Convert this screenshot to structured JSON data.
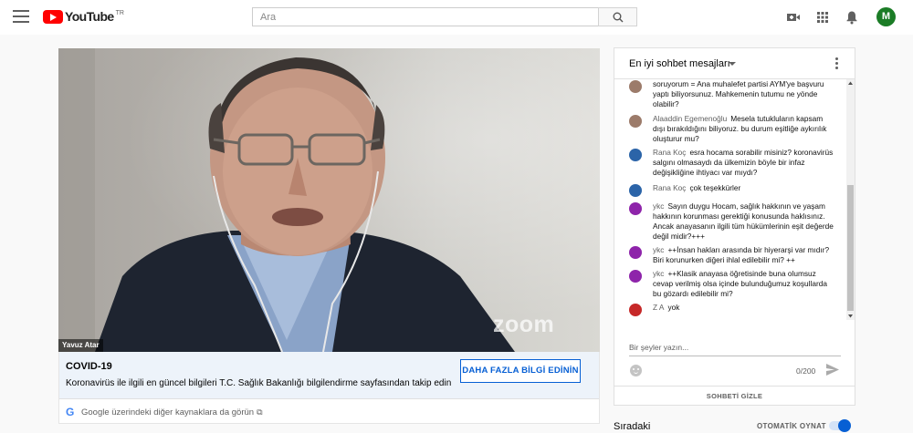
{
  "header": {
    "logo_text": "YouTube",
    "logo_country": "TR",
    "search_placeholder": "Ara",
    "icons": [
      "menu-icon",
      "search-icon",
      "create-video-icon",
      "apps-icon",
      "notifications-icon"
    ],
    "avatar_letter": "M",
    "avatar_color": "#1b7c26"
  },
  "video": {
    "speaker_name": "Yavuz Atar",
    "watermark": "zoom"
  },
  "info_panel": {
    "title": "COVID-19",
    "description": "Koronavirüs ile ilgili en güncel bilgileri T.C. Sağlık Bakanlığı bilgilendirme sayfasından takip edin",
    "button_label": "DAHA FAZLA BİLGİ EDİNİN",
    "source_link": "Google üzerindeki diğer kaynaklara da görün"
  },
  "chat": {
    "mode_label": "En iyi sohbet mesajları",
    "messages": [
      {
        "author": "",
        "text": "soruyorum = Ana muhalefet partisi AYM'ye başvuru yaptı biliyorsunuz. Mahkemenin tutumu ne yönde olabilir?",
        "avatar_color": "#9c7b6a"
      },
      {
        "author": "Alaaddin Egemenoğlu",
        "text": "Mesela tutukluların kapsam dışı bırakıldığını biliyoruz. bu durum eşitliğe aykırılık oluşturur mu?",
        "avatar_color": "#9c7b6a"
      },
      {
        "author": "Rana Koç",
        "text": "esra hocama sorabilir misiniz? koronavirüs salgını olmasaydı da ülkemizin böyle bir infaz değişikliğine ihtiyacı var mıydı?",
        "avatar_color": "#2b64a8"
      },
      {
        "author": "Rana Koç",
        "text": "çok teşekkürler",
        "avatar_color": "#2b64a8"
      },
      {
        "author": "ykc",
        "text": "Sayın duygu Hocam, sağlık hakkının ve yaşam hakkının korunması gerektiği konusunda haklısınız. Ancak anayasanın ilgili tüm hükümlerinin eşit değerde değil midir?+++",
        "avatar_color": "#8e24aa"
      },
      {
        "author": "ykc",
        "text": "++İnsan hakları arasında bir hiyerarşi var mıdır? Biri korunurken diğeri ihlal edilebilir mi? ++",
        "avatar_color": "#8e24aa"
      },
      {
        "author": "ykc",
        "text": "++Klasik anayasa öğretisinde buna olumsuz cevap verilmiş olsa içinde bulunduğumuz koşullarda bu gözardı edilebilir mi?",
        "avatar_color": "#8e24aa"
      },
      {
        "author": "Z A",
        "text": "yok",
        "avatar_color": "#c62828"
      }
    ],
    "input_placeholder": "Bir şeyler yazın...",
    "char_counter": "0/200",
    "hide_label": "SOHBETİ GİZLE"
  },
  "up_next": {
    "title": "Sıradaki",
    "autoplay_label": "OTOMATİK OYNAT",
    "autoplay_on": true
  }
}
